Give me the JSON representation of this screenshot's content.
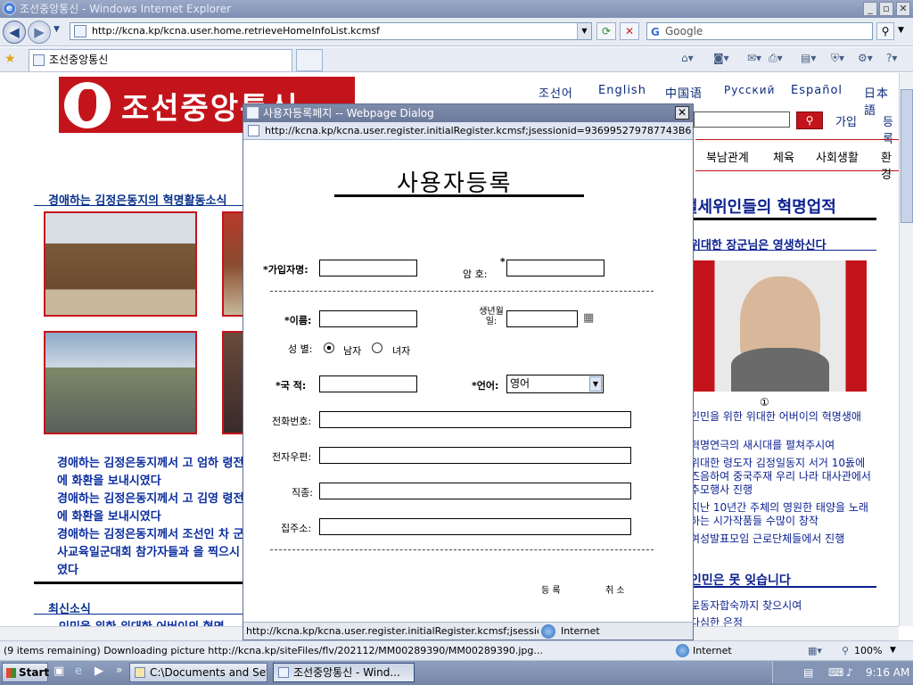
{
  "window": {
    "title": "조선중앙통신 - Windows Internet Explorer"
  },
  "nav": {
    "url": "http://kcna.kp/kcna.user.home.retrieveHomeInfoList.kcmsf",
    "search_placeholder": "Google"
  },
  "tab": {
    "label": "조선중앙통신"
  },
  "page": {
    "languages": [
      "조선어",
      "English",
      "中国语",
      "Русский",
      "Español",
      "日本語"
    ],
    "login_label": "가입",
    "login2_label": "등록",
    "menu": [
      "북남관계",
      "체육",
      "사회생활",
      "환경"
    ],
    "section_left_title": "경애하는 김정은동지의 혁명활동소식",
    "section_right_title": "절세위인들의 혁명업적",
    "right_subtitle": "위대한 장군님은 영생하신다",
    "photo_caption": "①",
    "left_articles": [
      "경애하는 김정은동지께서 고 엄하 령전에 화환을 보내시였다",
      "경애하는 김정은동지께서 고 김영 령전에 화환을 보내시였다",
      "경애하는 김정은동지께서 조선인 차 군사교육일군대회 참가자들과 을 찍으시였다"
    ],
    "right_articles": [
      "인민을 위한 위대한 어버이의 혁명생애",
      "혁명연극의 새시대를 펼쳐주시여",
      "위대한 령도자 김정일동지 서거 10돐에 즈음하여 중국주재 우리 나라 대사관에서 추모행사 진행",
      "지난 10년간 주체의 영원한 태양을 노래하는 시가작품들 수많이 창작",
      "여성발표모임 근로단체들에서 진행"
    ],
    "right_section2_title": "인민은 못 잊습니다",
    "right_articles2": [
      "로동자합숙까지 찾으시여",
      "다심한 은정"
    ],
    "latest_news_title": "최신소식",
    "latest_news_item": "인민을 위한 위대한 어버이의 혁명"
  },
  "dialog": {
    "title": "사용자등록페지 -- Webpage Dialog",
    "url": "http://kcna.kp/kcna.user.register.initialRegister.kcmsf;jsessionid=936995279787743B61825EC3DE",
    "heading": "사용자등록",
    "fields": {
      "username_label": "*가입자명:",
      "password_label": "암    호:",
      "password_star": "*",
      "name_label": "*이름:",
      "birth_label": "생년월일:",
      "gender_label": "성  별:",
      "gender_male": "남자",
      "gender_female": "녀자",
      "nationality_label": "*국   적:",
      "language_label": "*언어:",
      "language_value": "영어",
      "phone_label": "전화번호:",
      "email_label": "전자우편:",
      "job_label": "직종:",
      "address_label": "집주소:"
    },
    "register_button": "등 록",
    "cancel_button": "취 소",
    "status_url": "http://kcna.kp/kcna.user.register.initialRegister.kcmsf;jsessionid=936",
    "status_zone": "Internet"
  },
  "statusbar": {
    "message": "(9 items remaining) Downloading picture http://kcna.kp/siteFiles/flv/202112/MM00289390/MM00289390.jpg...",
    "zone": "Internet",
    "zoom": "100%"
  },
  "taskbar": {
    "start": "Start",
    "tasks": [
      "C:\\Documents and Settin...",
      "조선중앙통신 - Wind..."
    ],
    "time": "9:16 AM"
  }
}
